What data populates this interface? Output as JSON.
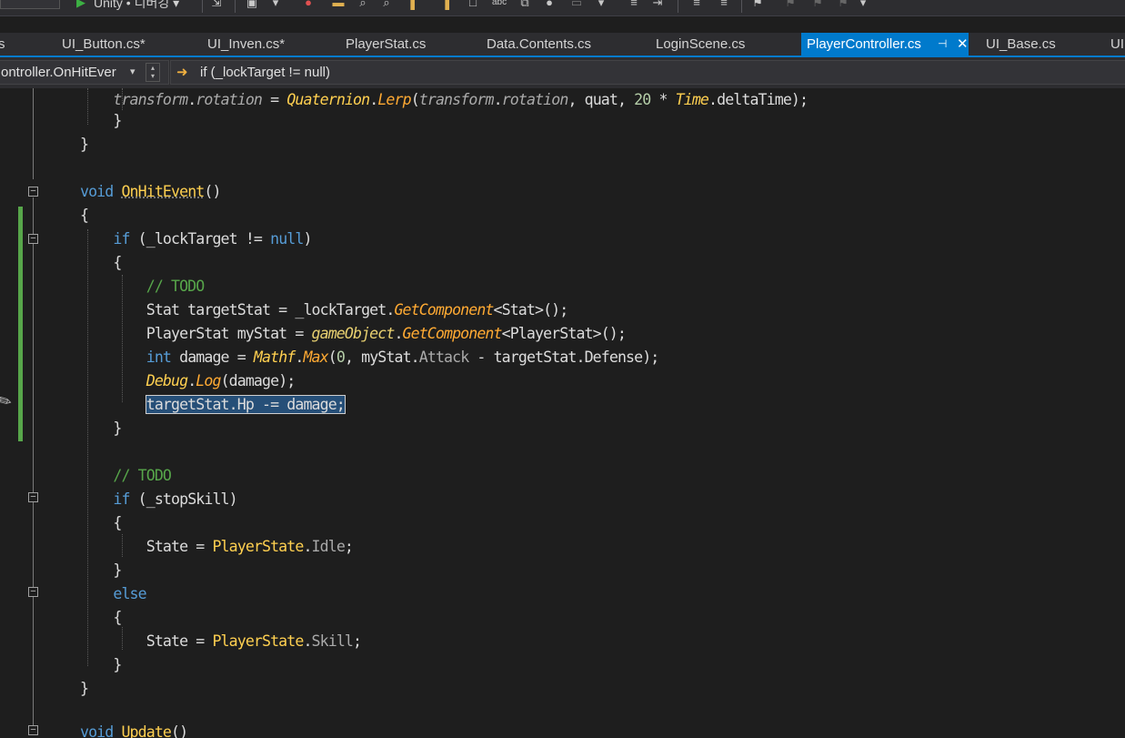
{
  "toolbar": {
    "target_label": "Unity • 디버깅 ▾"
  },
  "tabs": [
    {
      "label": "s"
    },
    {
      "label": "UI_Button.cs*"
    },
    {
      "label": "UI_Inven.cs*"
    },
    {
      "label": "PlayerStat.cs"
    },
    {
      "label": "Data.Contents.cs"
    },
    {
      "label": "LoginScene.cs"
    },
    {
      "label": "PlayerController.cs",
      "active": true
    },
    {
      "label": "UI_Base.cs"
    },
    {
      "label": "UI"
    }
  ],
  "tab_pin_icon": "pin-icon",
  "tab_close_icon": "close-icon",
  "navbar": {
    "member_combo": "ontroller.OnHitEver",
    "scope_combo": "if (_lockTarget != null)",
    "scope_icon": "arrow-right-icon"
  },
  "code": {
    "accent_color": "#007acc",
    "selection_color": "#264f78",
    "lines": [
      "        transform.rotation = Quaternion.Lerp(transform.rotation, quat, 20 * Time.deltaTime);",
      "    }",
      "}",
      "",
      "void OnHitEvent()",
      "{",
      "    if (_lockTarget != null)",
      "    {",
      "        // TODO",
      "        Stat targetStat = _lockTarget.GetComponent<Stat>();",
      "        PlayerStat myStat = gameObject.GetComponent<PlayerStat>();",
      "        int damage = Mathf.Max(0, myStat.Attack - targetStat.Defense);",
      "        Debug.Log(damage);",
      "        targetStat.Hp -= damage;",
      "    }",
      "",
      "    // TODO",
      "    if (_stopSkill)",
      "    {",
      "        State = PlayerState.Idle;",
      "    }",
      "    else",
      "    {",
      "        State = PlayerState.Skill;",
      "    }",
      "}",
      "",
      "void Update()"
    ],
    "selected_text": "targetStat.Hp -= damage;"
  }
}
